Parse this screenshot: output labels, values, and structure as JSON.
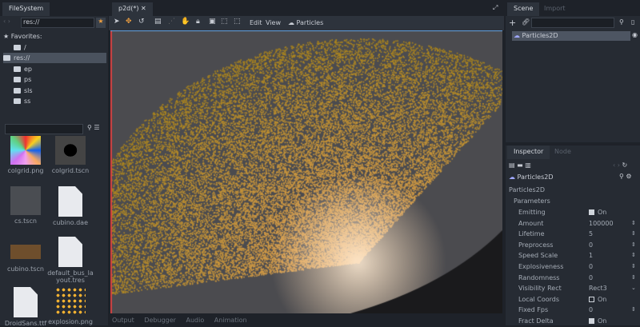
{
  "filesystem": {
    "tab": "FileSystem",
    "path": "res://",
    "tree": [
      {
        "label": "Favorites:",
        "level": 0
      },
      {
        "label": "/",
        "level": 1
      },
      {
        "label": "res://",
        "level": 0
      },
      {
        "label": "ep",
        "level": 1
      },
      {
        "label": "ps",
        "level": 1
      },
      {
        "label": "sls",
        "level": 1
      },
      {
        "label": "ss",
        "level": 1
      }
    ],
    "search_placeholder": "",
    "files": [
      "colgrid.png",
      "colgrid.tscn",
      "cs.tscn",
      "cubino.dae",
      "cubino.tscn",
      "default_bus_layout.tres",
      "DroidSans.ttf",
      "explosion.png"
    ]
  },
  "editor": {
    "tab": "p2d(*)",
    "menu": [
      "Edit",
      "View"
    ],
    "particles_menu": "Particles",
    "bottom_tabs": [
      "Output",
      "Debugger",
      "Audio",
      "Animation"
    ]
  },
  "scene": {
    "tabs": [
      "Scene",
      "Import"
    ],
    "node": "Particles2D"
  },
  "inspector": {
    "tabs": [
      "Inspector",
      "Node"
    ],
    "object": "Particles2D",
    "class": "Particles2D",
    "section": "Parameters",
    "props": [
      {
        "name": "Emitting",
        "value": "On",
        "type": "check",
        "checked": true
      },
      {
        "name": "Amount",
        "value": "100000",
        "type": "spin"
      },
      {
        "name": "Lifetime",
        "value": "5",
        "type": "spin"
      },
      {
        "name": "Preprocess",
        "value": "0",
        "type": "spin"
      },
      {
        "name": "Speed Scale",
        "value": "1",
        "type": "spin"
      },
      {
        "name": "Explosiveness",
        "value": "0",
        "type": "spin"
      },
      {
        "name": "Randomness",
        "value": "0",
        "type": "spin"
      },
      {
        "name": "Visibility Rect",
        "value": "Rect3",
        "type": "select"
      },
      {
        "name": "Local Coords",
        "value": "On",
        "type": "check",
        "checked": false
      },
      {
        "name": "Fixed Fps",
        "value": "0",
        "type": "spin"
      },
      {
        "name": "Fract Delta",
        "value": "On",
        "type": "check",
        "checked": true
      }
    ]
  }
}
